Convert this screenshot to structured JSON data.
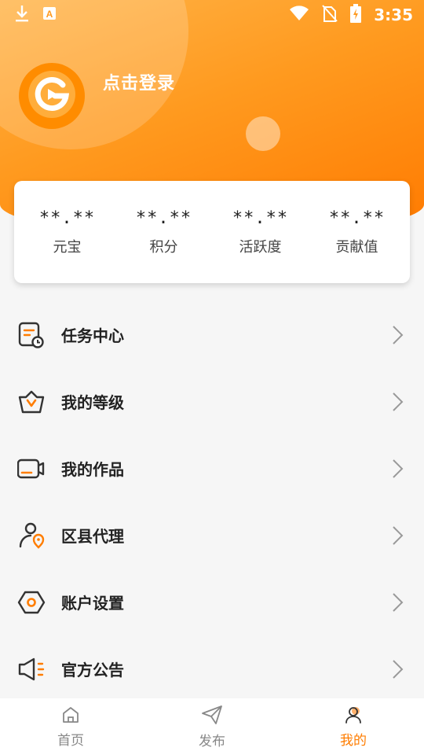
{
  "status_bar": {
    "time": "3:35",
    "left_icons": [
      "download-icon",
      "a-icon"
    ],
    "right_icons": [
      "wifi-icon",
      "no-sim-icon",
      "battery-charging-icon"
    ]
  },
  "profile": {
    "login_text": "点击登录",
    "avatar_icon": "app-logo-icon"
  },
  "stats": [
    {
      "value": "**.**",
      "label": "元宝"
    },
    {
      "value": "**.**",
      "label": "积分"
    },
    {
      "value": "**.**",
      "label": "活跃度"
    },
    {
      "value": "**.**",
      "label": "贡献值"
    }
  ],
  "menu": [
    {
      "label": "任务中心",
      "icon": "task-icon"
    },
    {
      "label": "我的等级",
      "icon": "crown-icon"
    },
    {
      "label": "我的作品",
      "icon": "video-icon"
    },
    {
      "label": "区县代理",
      "icon": "agent-location-icon"
    },
    {
      "label": "账户设置",
      "icon": "settings-hexagon-icon"
    },
    {
      "label": "官方公告",
      "icon": "megaphone-icon"
    }
  ],
  "tabbar": [
    {
      "label": "首页",
      "icon": "home-icon",
      "active": false
    },
    {
      "label": "发布",
      "icon": "send-icon",
      "active": false
    },
    {
      "label": "我的",
      "icon": "user-icon",
      "active": true
    }
  ],
  "colors": {
    "accent": "#ff7d00",
    "header_start": "#ffb347",
    "header_end": "#ff7a00"
  }
}
